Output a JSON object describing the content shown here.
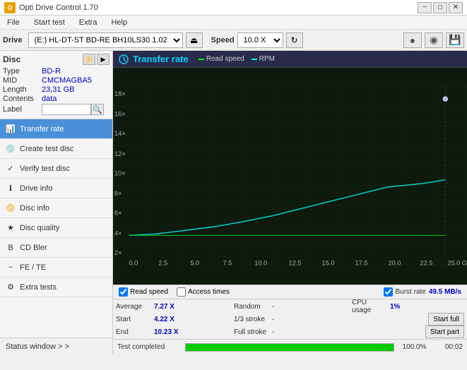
{
  "titleBar": {
    "title": "Opti Drive Control 1.70",
    "iconText": "O",
    "minBtn": "−",
    "maxBtn": "□",
    "closeBtn": "✕"
  },
  "menuBar": {
    "items": [
      "File",
      "Start test",
      "Extra",
      "Help"
    ]
  },
  "driveToolbar": {
    "driveLabel": "Drive",
    "driveValue": "(E:) HL-DT-ST BD-RE  BH10LS30 1.02",
    "ejectIcon": "⏏",
    "speedLabel": "Speed",
    "speedValue": "10.0 X",
    "refreshIcon": "↻",
    "icon1": "●",
    "icon2": "◉",
    "saveIcon": "💾"
  },
  "disc": {
    "title": "Disc",
    "rows": [
      {
        "label": "Type",
        "value": "BD-R"
      },
      {
        "label": "MID",
        "value": "CMCMAGBA5"
      },
      {
        "label": "Length",
        "value": "23,31 GB"
      },
      {
        "label": "Contents",
        "value": "data"
      },
      {
        "label": "Label",
        "value": ""
      }
    ]
  },
  "nav": {
    "items": [
      {
        "label": "Transfer rate",
        "icon": "📊",
        "active": true
      },
      {
        "label": "Create test disc",
        "icon": "💿",
        "active": false
      },
      {
        "label": "Verify test disc",
        "icon": "✓",
        "active": false
      },
      {
        "label": "Drive info",
        "icon": "ℹ",
        "active": false
      },
      {
        "label": "Disc info",
        "icon": "📀",
        "active": false
      },
      {
        "label": "Disc quality",
        "icon": "★",
        "active": false
      },
      {
        "label": "CD Bler",
        "icon": "B",
        "active": false
      },
      {
        "label": "FE / TE",
        "icon": "~",
        "active": false
      },
      {
        "label": "Extra tests",
        "icon": "⚙",
        "active": false
      }
    ]
  },
  "statusWindow": {
    "label": "Status window > >"
  },
  "chart": {
    "title": "Transfer rate",
    "legendRead": "Read speed",
    "legendRPM": "RPM",
    "yAxisLabels": [
      "18×",
      "16×",
      "14×",
      "12×",
      "10×",
      "8×",
      "6×",
      "4×",
      "2×"
    ],
    "xAxisLabels": [
      "0.0",
      "2.5",
      "5.0",
      "7.5",
      "10.0",
      "12.5",
      "15.0",
      "17.5",
      "20.0",
      "22.5",
      "25.0 GB"
    ]
  },
  "checkboxes": {
    "readSpeed": {
      "label": "Read speed",
      "checked": true
    },
    "accessTimes": {
      "label": "Access times",
      "checked": false
    },
    "burstRate": {
      "label": "Burst rate",
      "checked": true,
      "value": "49.5 MB/s"
    }
  },
  "stats": {
    "average": {
      "label": "Average",
      "value": "7.27 X"
    },
    "start": {
      "label": "Start",
      "value": "4.22 X"
    },
    "end": {
      "label": "End",
      "value": "10.23 X"
    },
    "random": {
      "label": "Random",
      "value": "-"
    },
    "stroke13": {
      "label": "1/3 stroke",
      "value": "-"
    },
    "fullStroke": {
      "label": "Full stroke",
      "value": "-"
    },
    "cpuUsage": {
      "label": "CPU usage",
      "value": "1%"
    },
    "startFull": {
      "label": "Start full"
    },
    "startPart": {
      "label": "Start part"
    }
  },
  "progressBar": {
    "text": "Test completed",
    "percent": "100.0%",
    "time": "00:02"
  }
}
